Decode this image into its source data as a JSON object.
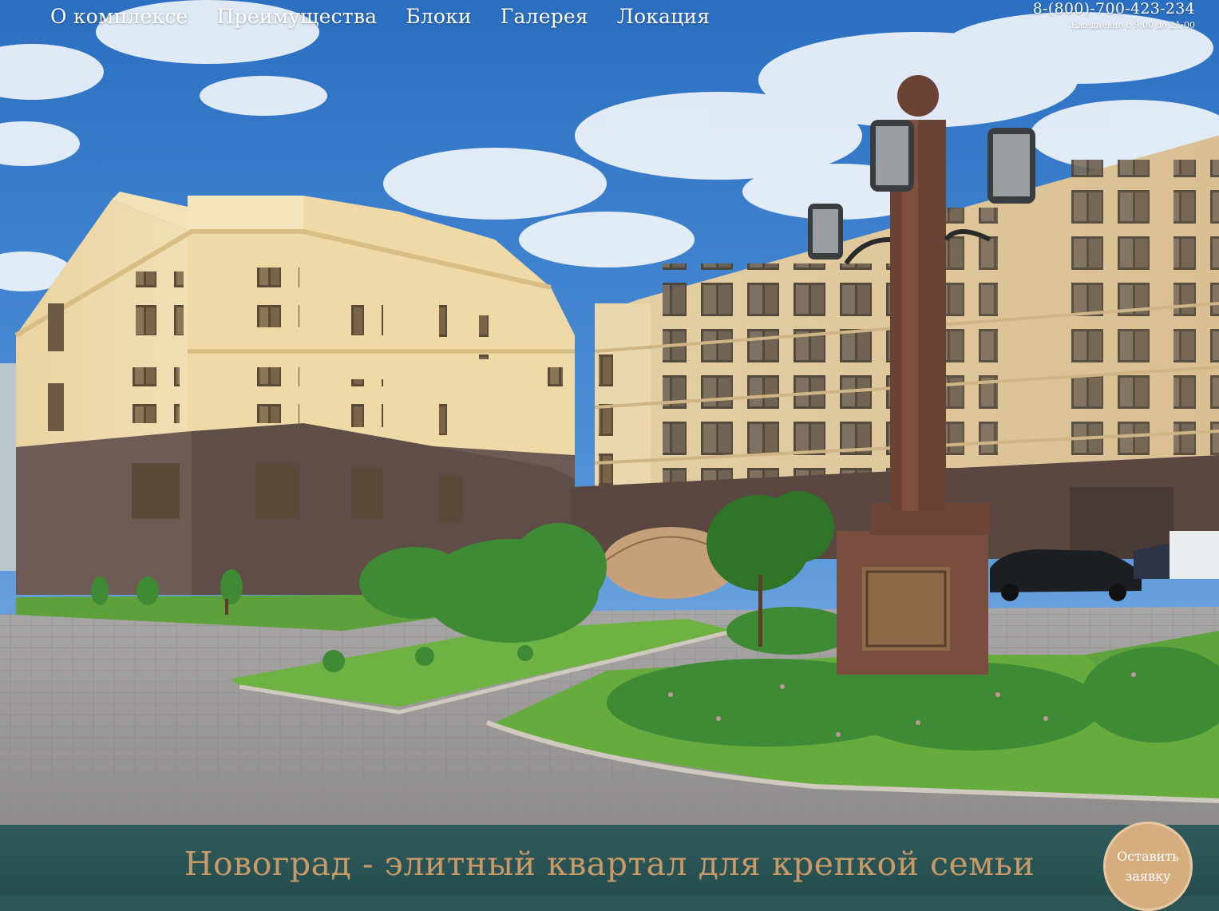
{
  "nav": {
    "items": [
      {
        "label": "О комплексе"
      },
      {
        "label": "Преимущества"
      },
      {
        "label": "Блоки"
      },
      {
        "label": "Галерея"
      },
      {
        "label": "Локация"
      }
    ]
  },
  "contact": {
    "phone": "8-(800)-700-423-234",
    "hours": "Ежедневно с 9:00 до 21:00"
  },
  "banner": {
    "tagline": "Новоград - элитный квартал для крепкой семьи",
    "cta_label": "Оставить заявку"
  },
  "colors": {
    "banner_bg": "#2c5556",
    "tagline": "#c79a67",
    "cta_bg": "#d6ad7e"
  }
}
